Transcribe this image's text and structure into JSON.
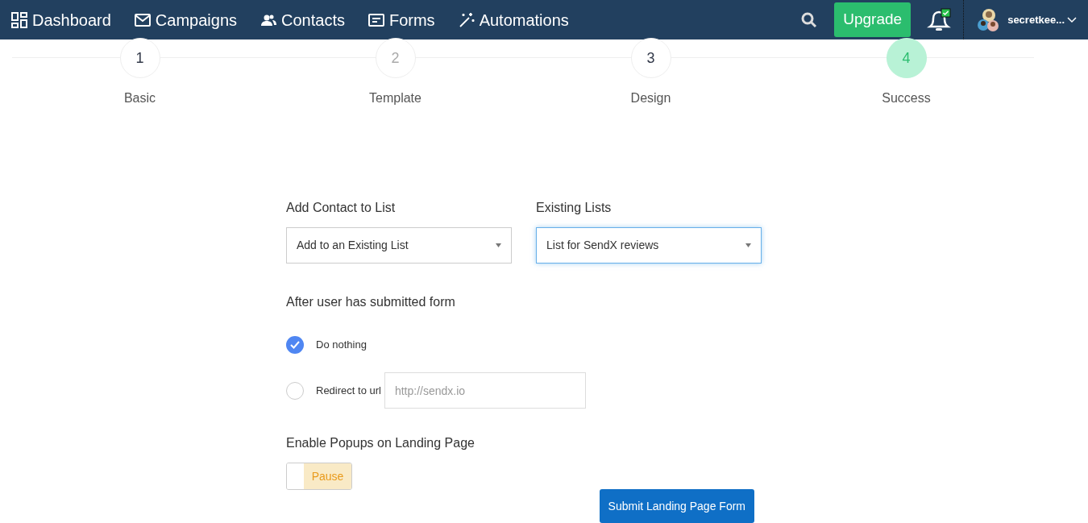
{
  "nav": {
    "items": [
      {
        "kind": "dashboard",
        "label": "Dashboard"
      },
      {
        "kind": "campaigns",
        "label": "Campaigns"
      },
      {
        "kind": "contacts",
        "label": "Contacts"
      },
      {
        "kind": "forms",
        "label": "Forms"
      },
      {
        "kind": "automations",
        "label": "Automations"
      }
    ],
    "upgrade": "Upgrade",
    "user": "secretkee..."
  },
  "steps": [
    {
      "number": "1",
      "label": "Basic",
      "selected": false,
      "disabled": false
    },
    {
      "number": "2",
      "label": "Template",
      "selected": false,
      "disabled": true
    },
    {
      "number": "3",
      "label": "Design",
      "selected": false,
      "disabled": false
    },
    {
      "number": "4",
      "label": "Success",
      "selected": true,
      "disabled": false
    }
  ],
  "form": {
    "add_contact": {
      "label": "Add Contact to List",
      "value": "Add to an Existing List"
    },
    "existing_lists": {
      "label": "Existing Lists",
      "value": "List for SendX reviews",
      "focused": true
    },
    "after_submit": {
      "label": "After user has submitted form",
      "options": [
        {
          "label": "Do nothing",
          "selected": true
        },
        {
          "label": "Redirect to url",
          "selected": false,
          "placeholder": "http://sendx.io"
        }
      ]
    },
    "popups": {
      "label": "Enable Popups on Landing Page",
      "toggle": {
        "label": "Pause",
        "on": false
      }
    },
    "submit": "Submit Landing Page Form"
  }
}
